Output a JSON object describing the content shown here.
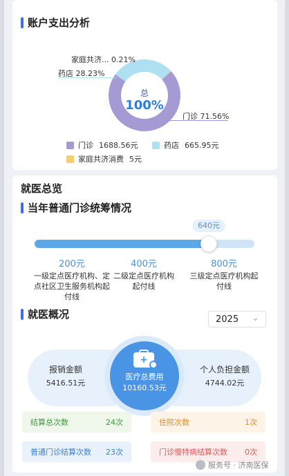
{
  "account": {
    "title": "账户支出分析",
    "center_label": "总",
    "center_value": "100%",
    "slices": [
      {
        "name": "门诊",
        "percent": 71.56,
        "callout": "门诊 71.56%",
        "color": "#a69ad4"
      },
      {
        "name": "药店",
        "percent": 28.23,
        "callout": "药店 28.23%",
        "color": "#aee0f2"
      },
      {
        "name": "家庭共济消费",
        "percent": 0.21,
        "callout": "家庭共济... 0.21%",
        "color": "#f3cf6f"
      }
    ],
    "legend": [
      {
        "name": "门诊",
        "amount": "1688.56元",
        "color": "#a69ad4"
      },
      {
        "name": "药店",
        "amount": "665.95元",
        "color": "#aee0f2"
      },
      {
        "name": "家庭共济消费",
        "amount": "5元",
        "color": "#f3cf6f"
      }
    ]
  },
  "overview": {
    "heading": "就医总览",
    "outpatient": {
      "title": "当年普通门诊统筹情况",
      "current_value": "640元",
      "progress_fraction": 0.8,
      "levels": [
        {
          "amount": "200元",
          "desc": "一级定点医疗机构、定点社区卫生服务机构起付线"
        },
        {
          "amount": "400元",
          "desc": "二级定点医疗机构起付线"
        },
        {
          "amount": "800元",
          "desc": "三级定点医疗机构起付线"
        }
      ]
    },
    "visits": {
      "title": "就医概况",
      "year": "2025",
      "reimbursed_label": "报销金额",
      "reimbursed_value": "5416.51元",
      "total_label": "医疗总费用",
      "total_value": "10160.53元",
      "personal_label": "个人负担金额",
      "personal_value": "4744.02元",
      "tiles": [
        {
          "label": "结算总次数",
          "value": "24次"
        },
        {
          "label": "住院次数",
          "value": "1次"
        },
        {
          "label": "普通门诊结算次数",
          "value": "23次"
        },
        {
          "label": "门诊慢特病结算次数",
          "value": "0次"
        }
      ]
    }
  },
  "watermark": "服务号 · 济南医保",
  "colors": {
    "accent": "#3f6fe0",
    "blue": "#4a94e6"
  }
}
